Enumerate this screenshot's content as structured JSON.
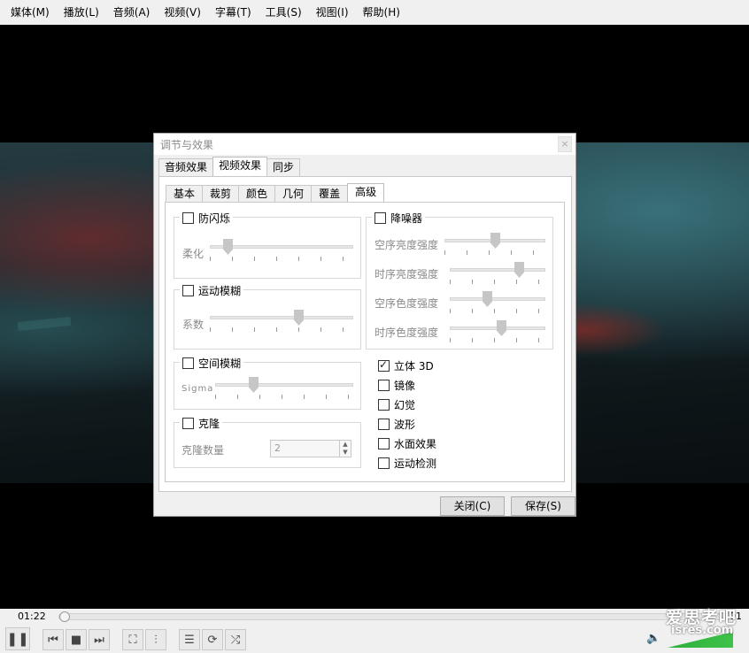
{
  "menu": [
    "媒体(M)",
    "播放(L)",
    "音频(A)",
    "视频(V)",
    "字幕(T)",
    "工具(S)",
    "视图(I)",
    "帮助(H)"
  ],
  "dialog": {
    "title": "调节与效果",
    "close_glyph": "×",
    "tabs": [
      "音频效果",
      "视频效果",
      "同步"
    ],
    "active_tab": "视频效果",
    "inner_tabs": [
      "基本",
      "裁剪",
      "颜色",
      "几何",
      "覆盖",
      "高级"
    ],
    "active_inner_tab": "高级",
    "anti_flicker": {
      "label": "防闪烁",
      "checked": false,
      "slider_label": "柔化",
      "value": 0.1
    },
    "motion_blur": {
      "label": "运动模糊",
      "checked": false,
      "slider_label": "系数",
      "value": 0.63
    },
    "spatial_blur": {
      "label": "空间模糊",
      "checked": false,
      "slider_label": "Sigma",
      "value": 0.26
    },
    "clone": {
      "label": "克隆",
      "checked": false,
      "field_label": "克隆数量",
      "value": "2"
    },
    "denoiser": {
      "label": "降噪器",
      "checked": false,
      "sliders": [
        {
          "label": "空序亮度强度",
          "value": 0.5
        },
        {
          "label": "时序亮度强度",
          "value": 0.75
        },
        {
          "label": "空序色度强度",
          "value": 0.38
        },
        {
          "label": "时序色度强度",
          "value": 0.55
        }
      ]
    },
    "options": [
      {
        "label": "立体 3D",
        "checked": true
      },
      {
        "label": "镜像",
        "checked": false
      },
      {
        "label": "幻觉",
        "checked": false
      },
      {
        "label": "波形",
        "checked": false
      },
      {
        "label": "水面效果",
        "checked": false
      },
      {
        "label": "运动检测",
        "checked": false
      }
    ],
    "close_button": "关闭(C)",
    "save_button": "保存(S)"
  },
  "player": {
    "current_time": "01:22",
    "end_time": "01",
    "progress": 0.0,
    "volume_label": ""
  },
  "watermark": {
    "line1": "爱思考吧",
    "line2": "isres.com"
  }
}
